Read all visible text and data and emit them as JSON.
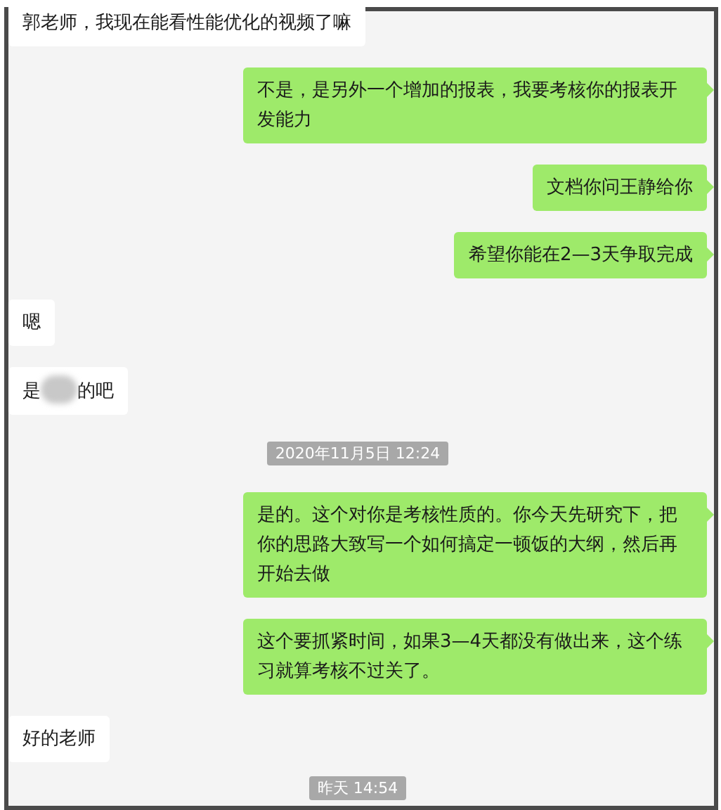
{
  "messages": [
    {
      "kind": "received",
      "text": "郭老师，我现在能看性能优化的视频了嘛"
    },
    {
      "kind": "sent",
      "text": "不是，是另外一个增加的报表，我要考核你的报表开发能力"
    },
    {
      "kind": "sent",
      "text": "文档你问王静给你"
    },
    {
      "kind": "sent",
      "text": "希望你能在2—3天争取完成"
    },
    {
      "kind": "received",
      "text": "嗯"
    },
    {
      "kind": "received",
      "text": "是",
      "redacted": true,
      "text_after": "的吧"
    },
    {
      "kind": "timestamp",
      "text": "2020年11月5日 12:24"
    },
    {
      "kind": "sent",
      "text": "是的。这个对你是考核性质的。你今天先研究下，把你的思路大致写一个如何搞定一顿饭的大纲，然后再开始去做"
    },
    {
      "kind": "sent",
      "text": "这个要抓紧时间，如果3—4天都没有做出来，这个练习就算考核不过关了。"
    },
    {
      "kind": "received",
      "text": "好的老师"
    },
    {
      "kind": "timestamp",
      "text": "昨天 14:54"
    }
  ]
}
